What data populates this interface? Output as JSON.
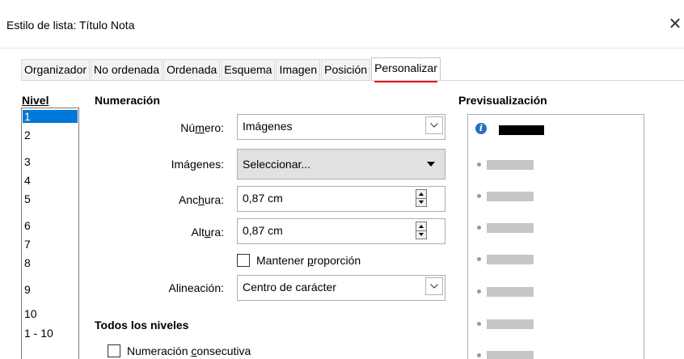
{
  "dialog": {
    "title": "Estilo de lista: Título Nota",
    "close_glyph": "✕"
  },
  "tabs": [
    {
      "label": "Organizador"
    },
    {
      "label": "No ordenada"
    },
    {
      "label": "Ordenada"
    },
    {
      "label": "Esquema"
    },
    {
      "label": "Imagen"
    },
    {
      "label": "Posición"
    },
    {
      "label": "Personalizar",
      "active": true
    }
  ],
  "nivel": {
    "label": "Nivel",
    "items": [
      "1",
      "2",
      "3",
      "4",
      "5",
      "6",
      "7",
      "8",
      "9",
      "10",
      "1 - 10"
    ],
    "selected": "1"
  },
  "numeracion": {
    "heading": "Numeración",
    "numero": {
      "label_pre": "Nú",
      "label_u": "m",
      "label_post": "ero:",
      "value": "Imágenes"
    },
    "imagenes": {
      "label_pre": "Imá",
      "label_u": "g",
      "label_post": "enes:",
      "value": "Seleccionar..."
    },
    "anchura": {
      "label_pre": "Anc",
      "label_u": "h",
      "label_post": "ura:",
      "value": "0,87 cm"
    },
    "altura": {
      "label_pre": "Alt",
      "label_u": "u",
      "label_post": "ra:",
      "value": "0,87 cm"
    },
    "mantener": {
      "label_pre": "Mantener ",
      "label_u": "p",
      "label_post": "roporción",
      "checked": false
    },
    "alineacion": {
      "label": "Alineación:",
      "value": "Centro de carácter"
    }
  },
  "todos": {
    "heading": "Todos los niveles",
    "consecutiva": {
      "label_pre": "Numeración ",
      "label_u": "c",
      "label_post": "onsecutiva",
      "checked": false
    }
  },
  "preview": {
    "heading": "Previsualización",
    "info_glyph": "i"
  },
  "colors": {
    "accent": "#e0141e",
    "selection": "#0078d7"
  }
}
